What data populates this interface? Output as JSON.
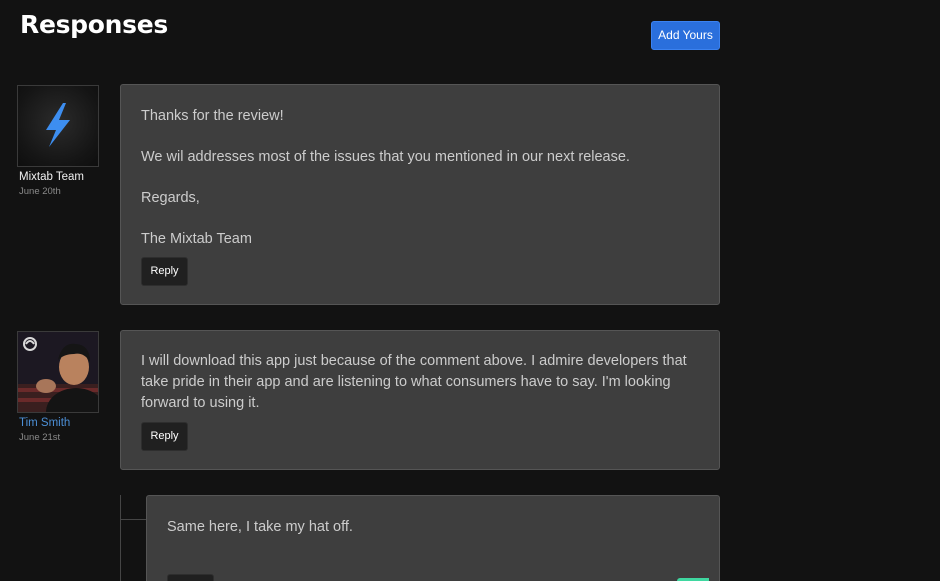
{
  "header": {
    "title": "Responses",
    "add_button_label": "Add Yours"
  },
  "colors": {
    "accent": "#2a6fdc",
    "background": "#121212",
    "card": "#3e3e3e",
    "author_link": "#4c8fd6"
  },
  "comments": [
    {
      "author": "Mixtab Team",
      "date": "June 20th",
      "avatar_icon": "lightning-bolt-icon",
      "paragraphs": [
        "Thanks for the review!",
        "We wil addresses most of the issues that you mentioned in our next release.",
        "Regards,",
        "The Mixtab Team"
      ],
      "reply_label": "Reply"
    },
    {
      "author": "Tim Smith",
      "date": "June 21st",
      "avatar_icon": "user-photo-icon",
      "paragraphs": [
        "I will download this app just because of the comment above. I admire developers that take pride in their app and are listening to what consumers have to say. I'm looking forward to using it."
      ],
      "reply_label": "Reply"
    },
    {
      "paragraphs": [
        "Same here, I take my hat off."
      ]
    }
  ]
}
